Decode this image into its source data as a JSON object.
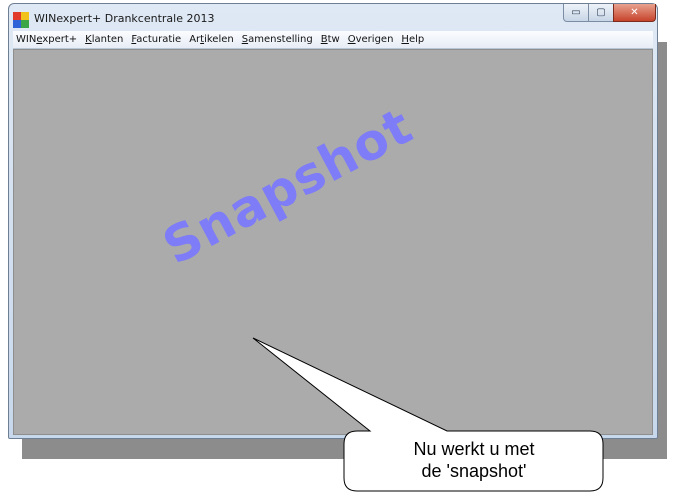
{
  "window": {
    "title": "WINexpert+ Drankcentrale 2013",
    "controls": {
      "minimize": "▭",
      "maximize": "▢",
      "close": "✕"
    }
  },
  "menu": [
    {
      "pre": "WIN",
      "key": "e",
      "post": "xpert+"
    },
    {
      "pre": "",
      "key": "K",
      "post": "lanten"
    },
    {
      "pre": "",
      "key": "F",
      "post": "acturatie"
    },
    {
      "pre": "Ar",
      "key": "t",
      "post": "ikelen"
    },
    {
      "pre": "",
      "key": "S",
      "post": "amenstelling"
    },
    {
      "pre": "",
      "key": "B",
      "post": "tw"
    },
    {
      "pre": "",
      "key": "O",
      "post": "verigen"
    },
    {
      "pre": "",
      "key": "H",
      "post": "elp"
    }
  ],
  "watermark": "Snapshot",
  "callout": {
    "line1": "Nu werkt u met",
    "line2": "de 'snapshot'"
  },
  "icons": {
    "app": "app-logo-icon"
  }
}
